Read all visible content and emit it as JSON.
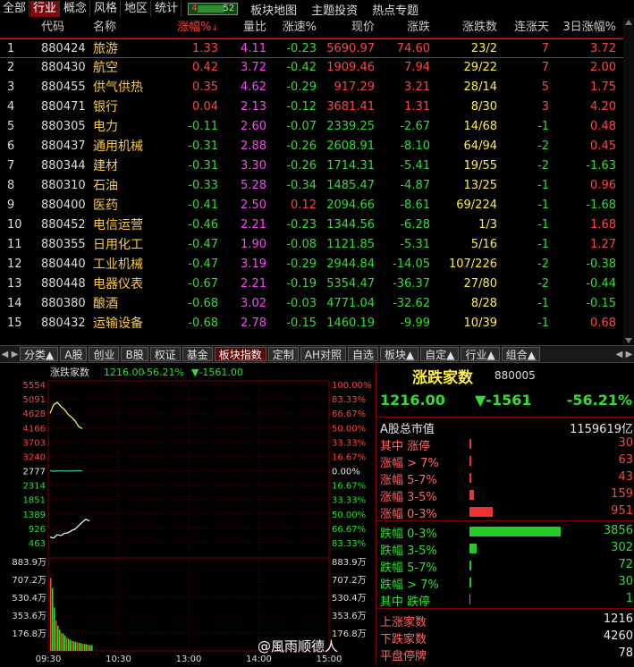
{
  "topbar": {
    "tabs": [
      "全部",
      "行业",
      "概念",
      "风格",
      "地区",
      "统计"
    ],
    "active": 1,
    "slider_left": "4",
    "slider_right": "52",
    "right_tabs": [
      "板块地图",
      "主题投资",
      "热点专题"
    ]
  },
  "table": {
    "headers": [
      "代码",
      "名称",
      "涨幅%",
      "量比",
      "涨速%",
      "现价",
      "涨跌",
      "涨跌数",
      "连涨天",
      "3日涨幅%"
    ],
    "sort_arrow": "↓",
    "rows": [
      {
        "i": "1",
        "code": "880424",
        "name": "旅游",
        "chg": "1.33",
        "vr": "4.11",
        "spd": "-0.23",
        "price": "5690.97",
        "diff": "74.60",
        "ud": "23/2",
        "days": "7",
        "chg3": "3.72"
      },
      {
        "i": "2",
        "code": "880430",
        "name": "航空",
        "chg": "0.42",
        "vr": "3.72",
        "spd": "-0.42",
        "price": "1909.46",
        "diff": "7.94",
        "ud": "29/22",
        "days": "7",
        "chg3": "2.00"
      },
      {
        "i": "3",
        "code": "880455",
        "name": "供气供热",
        "chg": "0.35",
        "vr": "4.62",
        "spd": "-0.29",
        "price": "917.29",
        "diff": "3.21",
        "ud": "28/14",
        "days": "5",
        "chg3": "1.75"
      },
      {
        "i": "4",
        "code": "880471",
        "name": "银行",
        "chg": "0.04",
        "vr": "2.13",
        "spd": "-0.12",
        "price": "3681.41",
        "diff": "1.31",
        "ud": "8/30",
        "days": "3",
        "chg3": "4.20"
      },
      {
        "i": "5",
        "code": "880305",
        "name": "电力",
        "chg": "-0.11",
        "vr": "2.60",
        "spd": "-0.07",
        "price": "2339.25",
        "diff": "-2.67",
        "ud": "14/68",
        "days": "-1",
        "chg3": "0.48"
      },
      {
        "i": "6",
        "code": "880437",
        "name": "通用机械",
        "chg": "-0.31",
        "vr": "2.88",
        "spd": "-0.26",
        "price": "2608.91",
        "diff": "-8.10",
        "ud": "64/94",
        "days": "-2",
        "chg3": "0.45"
      },
      {
        "i": "7",
        "code": "880344",
        "name": "建材",
        "chg": "-0.31",
        "vr": "3.30",
        "spd": "-0.26",
        "price": "1714.31",
        "diff": "-5.41",
        "ud": "19/55",
        "days": "-2",
        "chg3": "-1.63"
      },
      {
        "i": "8",
        "code": "880310",
        "name": "石油",
        "chg": "-0.33",
        "vr": "5.28",
        "spd": "-0.34",
        "price": "1485.47",
        "diff": "-4.87",
        "ud": "13/25",
        "days": "-1",
        "chg3": "0.96"
      },
      {
        "i": "9",
        "code": "880400",
        "name": "医药",
        "chg": "-0.41",
        "vr": "2.50",
        "spd": "0.12",
        "price": "2094.66",
        "diff": "-8.61",
        "ud": "69/224",
        "days": "-1",
        "chg3": "-1.68"
      },
      {
        "i": "10",
        "code": "880452",
        "name": "电信运营",
        "chg": "-0.46",
        "vr": "2.21",
        "spd": "-0.23",
        "price": "1344.56",
        "diff": "-6.28",
        "ud": "1/3",
        "days": "-1",
        "chg3": "1.68"
      },
      {
        "i": "11",
        "code": "880355",
        "name": "日用化工",
        "chg": "-0.47",
        "vr": "1.90",
        "spd": "-0.08",
        "price": "1121.85",
        "diff": "-5.31",
        "ud": "5/16",
        "days": "-1",
        "chg3": "1.27"
      },
      {
        "i": "12",
        "code": "880440",
        "name": "工业机械",
        "chg": "-0.47",
        "vr": "3.19",
        "spd": "-0.29",
        "price": "2944.84",
        "diff": "-14.05",
        "ud": "107/226",
        "days": "-2",
        "chg3": "-0.38"
      },
      {
        "i": "13",
        "code": "880448",
        "name": "电器仪表",
        "chg": "-0.67",
        "vr": "2.21",
        "spd": "-0.19",
        "price": "5354.47",
        "diff": "-36.37",
        "ud": "27/80",
        "days": "-2",
        "chg3": "-0.44"
      },
      {
        "i": "14",
        "code": "880380",
        "name": "酿酒",
        "chg": "-0.68",
        "vr": "3.02",
        "spd": "-0.03",
        "price": "4771.04",
        "diff": "-32.62",
        "ud": "8/28",
        "days": "-1",
        "chg3": "-0.15"
      },
      {
        "i": "15",
        "code": "880432",
        "name": "运输设备",
        "chg": "-0.68",
        "vr": "2.78",
        "spd": "-0.15",
        "price": "1460.19",
        "diff": "-9.99",
        "ud": "10/39",
        "days": "-1",
        "chg3": "0.68"
      }
    ]
  },
  "bottom_tabs": [
    "分类▲",
    "A股",
    "创业",
    "B股",
    "权证",
    "基金",
    "板块指数",
    "定制",
    "AH对照",
    "自选",
    "板块▲",
    "自定▲",
    "行业▲",
    "组合▲"
  ],
  "bottom_active": 6,
  "chart": {
    "header_name": "涨跌家数",
    "header_value": "1216.00",
    "header_pct": "-56.21%",
    "header_diff": "▼-1561.00",
    "left_ticks": [
      "5554",
      "5091",
      "4628",
      "4166",
      "3703",
      "3240",
      "2777",
      "2314",
      "1851",
      "1389",
      "926",
      "463"
    ],
    "right_ticks": [
      "100.00%",
      "83.33%",
      "66.67%",
      "50.00%",
      "33.33%",
      "16.67%",
      "0.00%",
      "16.67%",
      "33.33%",
      "50.00%",
      "66.67%",
      "83.33%"
    ],
    "vol_left": [
      "883.9万",
      "707.2万",
      "530.4万",
      "353.6万",
      "176.8万"
    ],
    "vol_right": [
      "883.9万",
      "707.2万",
      "530.4万",
      "353.6万",
      "176.8万"
    ],
    "time_ticks": [
      "09:30",
      "10:30",
      "13:00",
      "14:00",
      "15:00"
    ],
    "line_top": [
      4628,
      4900,
      4980,
      4850,
      4750,
      4600,
      4500,
      4380,
      4200,
      4130
    ],
    "line_bottom": [
      640,
      610,
      720,
      690,
      760,
      780,
      850,
      900,
      1010,
      1120,
      1216,
      1160
    ],
    "mid_line": [
      2777,
      2760,
      2770,
      2775,
      2765,
      2770,
      2772,
      2768,
      2775,
      2770
    ],
    "volumes": [
      720,
      620,
      430,
      300,
      250,
      210,
      180,
      170,
      150,
      130,
      120,
      110,
      100,
      95,
      90,
      85,
      80,
      75,
      70,
      68,
      65,
      60,
      58,
      55
    ],
    "y_min": 0,
    "y_max": 5554,
    "vol_max": 883.9
  },
  "right": {
    "title": "涨跌家数",
    "code": "880005",
    "price": "1216.00",
    "diff": "▼-1561",
    "pct": "-56.21%",
    "mktcap_label": "A股总市值",
    "mktcap_value": "1159619亿",
    "up_rows": [
      {
        "label": "其中 涨停",
        "value": "30",
        "w": 2
      },
      {
        "label": "涨幅 > 7%",
        "value": "63",
        "w": 2
      },
      {
        "label": "涨幅 5-7%",
        "value": "43",
        "w": 2
      },
      {
        "label": "涨幅 3-5%",
        "value": "159",
        "w": 5
      },
      {
        "label": "涨幅 0-3%",
        "value": "951",
        "w": 26
      }
    ],
    "down_rows": [
      {
        "label": "跌幅 0-3%",
        "value": "3856",
        "w": 102
      },
      {
        "label": "跌幅 3-5%",
        "value": "302",
        "w": 8
      },
      {
        "label": "跌幅 5-7%",
        "value": "72",
        "w": 2
      },
      {
        "label": "跌幅 > 7%",
        "value": "30",
        "w": 2
      },
      {
        "label": "其中 跌停",
        "value": "1",
        "w": 1
      }
    ],
    "summary": [
      {
        "label": "上涨家数",
        "value": "1216"
      },
      {
        "label": "下跌家数",
        "value": "4260"
      },
      {
        "label": "平盘停牌",
        "value": "78"
      }
    ]
  },
  "watermark": "@風雨顺德人",
  "colors": {
    "up": "#ff4444",
    "down": "#33dd33",
    "name": "#ffcc33",
    "volume_ratio": "#ff44ff"
  }
}
